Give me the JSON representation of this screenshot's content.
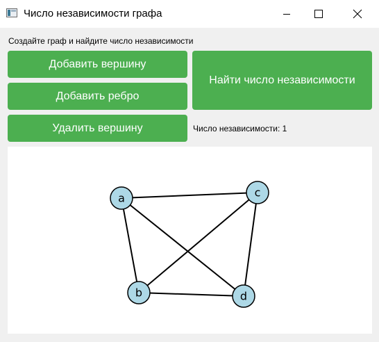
{
  "window": {
    "title": "Число независимости графа",
    "controls": [
      "minimize",
      "maximize",
      "close"
    ]
  },
  "instruction": "Создайте граф и найдите число независимости",
  "buttons": {
    "add_vertex": "Добавить вершину",
    "add_edge": "Добавить ребро",
    "delete_vertex": "Удалить вершину",
    "find": "Найти число независимости"
  },
  "result": {
    "text": "Число независимости: 1",
    "value": 1
  },
  "graph": {
    "node_fill": "#add8e6",
    "edge_color": "#000000",
    "nodes": [
      "a",
      "b",
      "c",
      "d"
    ],
    "edges": [
      [
        "a",
        "b"
      ],
      [
        "a",
        "c"
      ],
      [
        "a",
        "d"
      ],
      [
        "b",
        "c"
      ],
      [
        "b",
        "d"
      ],
      [
        "c",
        "d"
      ]
    ]
  },
  "colors": {
    "accent": "#4caf50",
    "button_text": "#ffffff",
    "background": "#f0f0f0"
  }
}
